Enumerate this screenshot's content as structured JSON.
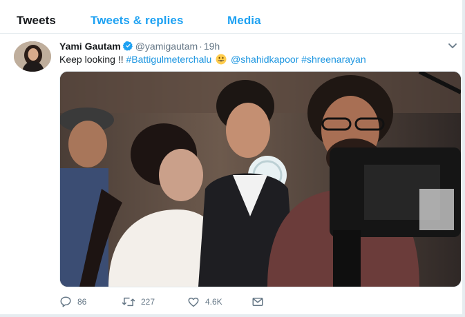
{
  "tabs": [
    {
      "label": "Tweets",
      "active": true
    },
    {
      "label": "Tweets & replies",
      "active": false
    },
    {
      "label": "Media",
      "active": false
    }
  ],
  "tweet": {
    "author": {
      "name": "Yami Gautam",
      "verified": true,
      "handle": "@yamigautam",
      "separator": "·",
      "time": "19h"
    },
    "text": {
      "intro": "Keep looking !! ",
      "hashtag1": "#Battigulmeterchalu",
      "emoji": "grinning-face-emoji",
      "mention": "@shahidkapoor",
      "hashtag2": "#shreenarayan"
    },
    "media": {
      "kind": "photo",
      "description_icon": "photo"
    },
    "actions": {
      "reply_count": "86",
      "retweet_count": "227",
      "like_count": "4.6K"
    }
  },
  "colors": {
    "link": "#1b95e0",
    "muted": "#657786",
    "tab_active": "#14171a",
    "tab_inactive": "#1da1f2",
    "verified": "#1da1f2"
  }
}
